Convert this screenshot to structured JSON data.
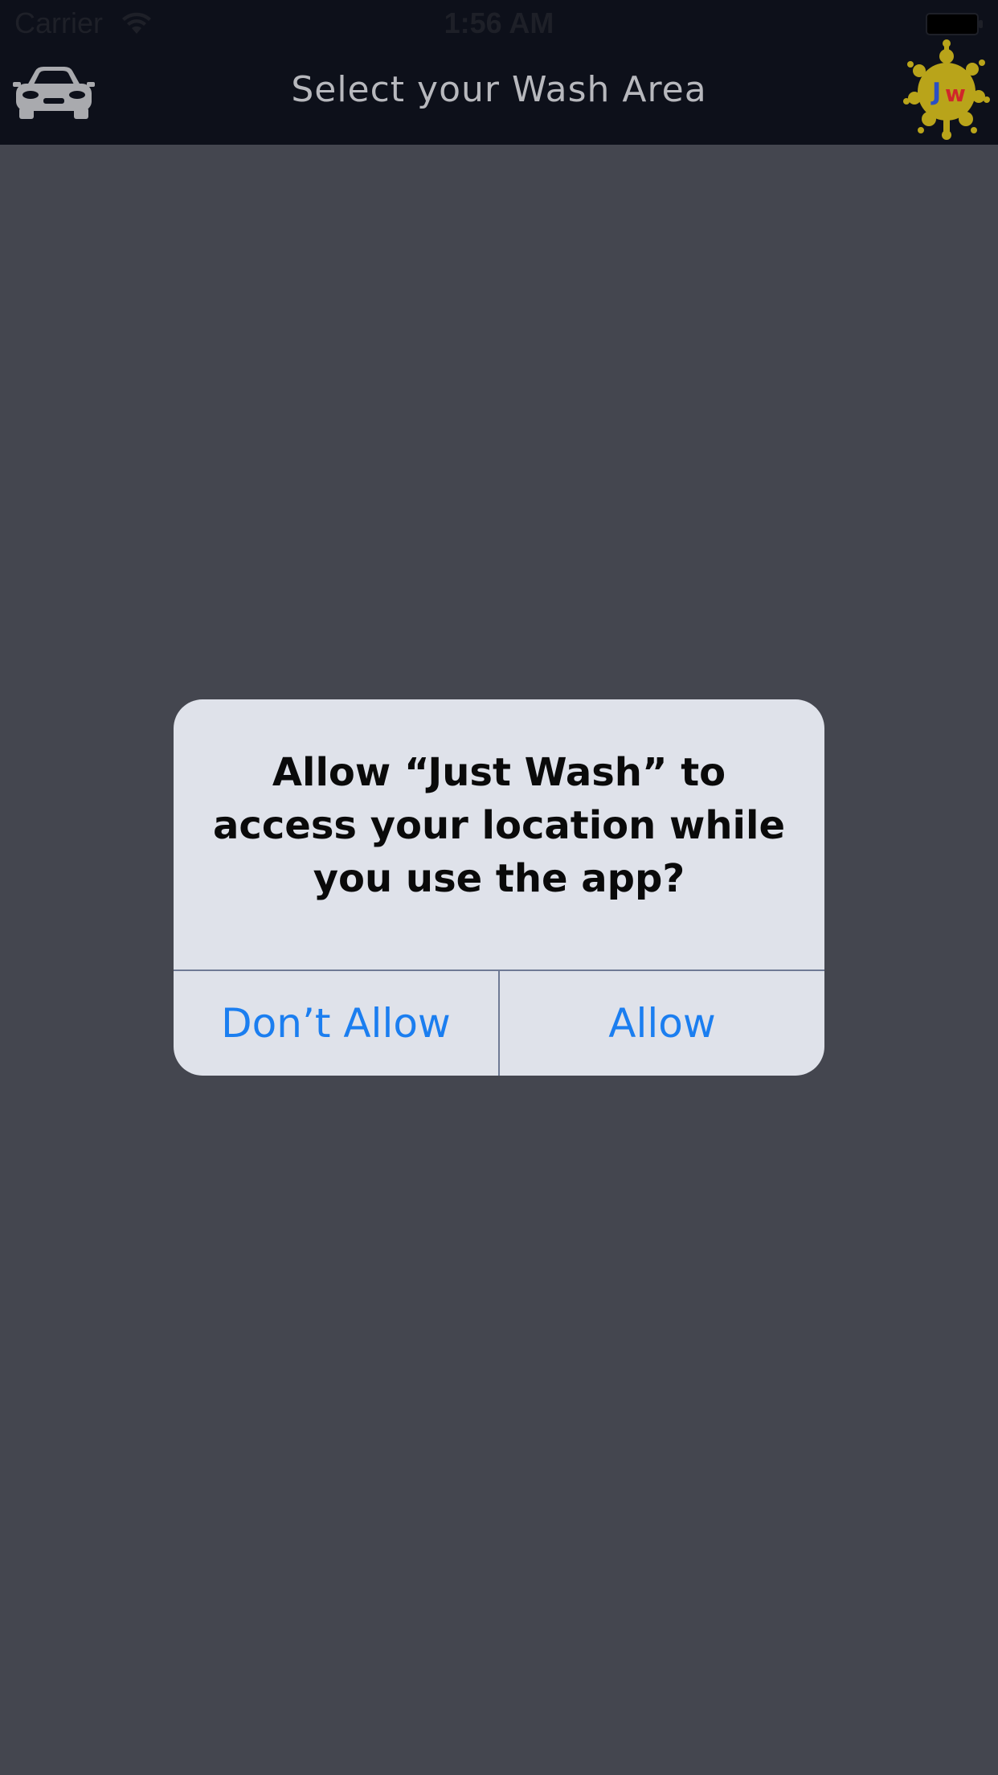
{
  "status_bar": {
    "carrier": "Carrier",
    "time": "1:56 AM",
    "wifi_icon": "wifi-icon",
    "battery_icon": "battery-icon"
  },
  "nav_bar": {
    "title": "Select your Wash Area",
    "left_icon": "car-icon",
    "right_icon": "just-wash-logo",
    "logo_text": "Jw"
  },
  "alert": {
    "message": "Allow “Just Wash” to access your location while you use the app?",
    "dont_allow_label": "Don’t Allow",
    "allow_label": "Allow"
  },
  "colors": {
    "header_background": "#0d101a",
    "screen_background": "#44464f",
    "alert_background": "#dfe2ea",
    "alert_button_text": "#1b7ef0",
    "logo_splash": "#b9a41a"
  }
}
